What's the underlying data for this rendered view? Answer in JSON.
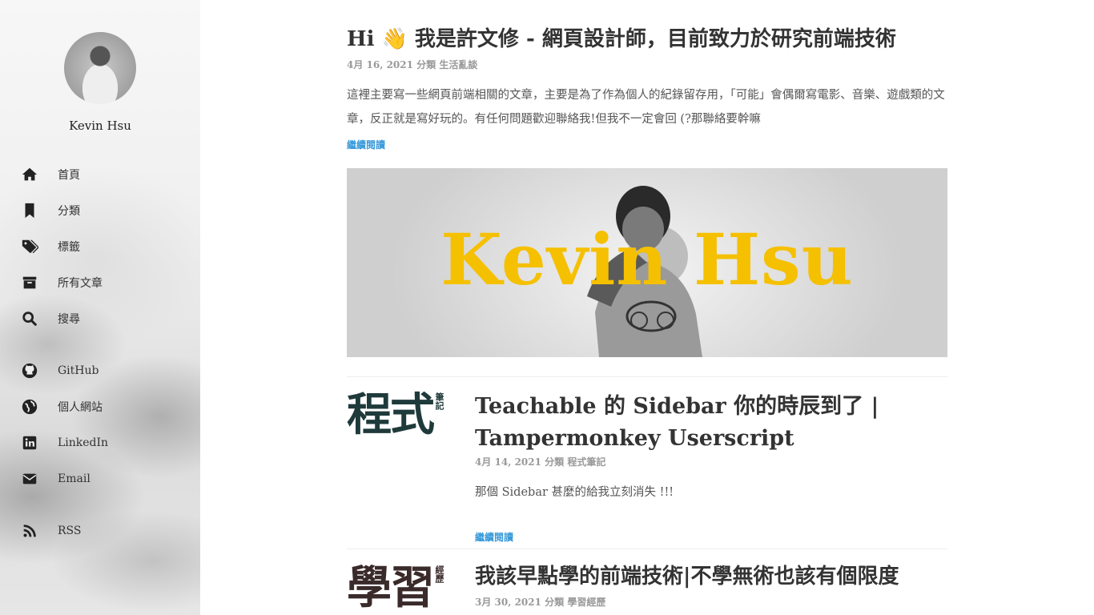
{
  "sidebar": {
    "site_name": "Kevin Hsu",
    "nav": [
      {
        "label": "首頁",
        "icon": "home-icon"
      },
      {
        "label": "分類",
        "icon": "bookmark-icon"
      },
      {
        "label": "標籤",
        "icon": "tags-icon"
      },
      {
        "label": "所有文章",
        "icon": "archive-icon"
      },
      {
        "label": "搜尋",
        "icon": "search-icon"
      }
    ],
    "links": [
      {
        "label": "GitHub",
        "icon": "github-icon"
      },
      {
        "label": "個人網站",
        "icon": "globe-icon"
      },
      {
        "label": "LinkedIn",
        "icon": "linkedin-icon"
      },
      {
        "label": "Email",
        "icon": "email-icon"
      }
    ],
    "rss": {
      "label": "RSS",
      "icon": "rss-icon"
    }
  },
  "posts": [
    {
      "title": "Hi 👋 我是許文修 - 網頁設計師，目前致力於研究前端技術",
      "meta": "4月 16, 2021 分類 生活亂談",
      "excerpt": "這裡主要寫一些網頁前端相關的文章，主要是為了作為個人的紀錄留存用，「可能」會偶爾寫電影、音樂、遊戲類的文章，反正就是寫好玩的。有任何問題歡迎聯絡我!但我不一定會回 (?那聯絡要幹嘛",
      "read_more": "繼續閱讀",
      "hero_text": "Kevin Hsu"
    },
    {
      "thumb_big": "程式",
      "thumb_small": "筆記",
      "title_line1": "Teachable 的 Sidebar 你的時辰到了 |",
      "title_line2": "Tampermonkey Userscript",
      "meta": "4月 14, 2021 分類 程式筆記",
      "excerpt": "那個 Sidebar 甚麼的給我立刻消失 !!!",
      "read_more": "繼續閱讀"
    },
    {
      "thumb_big": "學習",
      "thumb_small": "經歷",
      "title": "我該早點學的前端技術|不學無術也該有個限度",
      "meta": "3月 30, 2021 分類 學習經歷"
    }
  ],
  "colors": {
    "accent_link": "#3a9ad9",
    "hero_text": "#f5c000"
  }
}
